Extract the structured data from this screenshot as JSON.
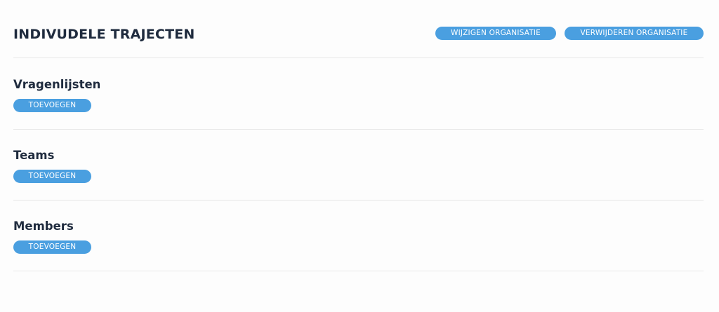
{
  "header": {
    "title": "INDIVUDELE TRAJECTEN",
    "edit_label": "WIJZIGEN ORGANISATIE",
    "delete_label": "VERWIJDEREN ORGANISATIE"
  },
  "sections": [
    {
      "title": "Vragenlijsten",
      "add_label": "TOEVOEGEN"
    },
    {
      "title": "Teams",
      "add_label": "TOEVOEGEN"
    },
    {
      "title": "Members",
      "add_label": "TOEVOEGEN"
    }
  ],
  "colors": {
    "accent": "#4a9fe0",
    "text": "#1f2b3e",
    "divider": "#e8e8e8",
    "background": "#fdfdfd"
  }
}
